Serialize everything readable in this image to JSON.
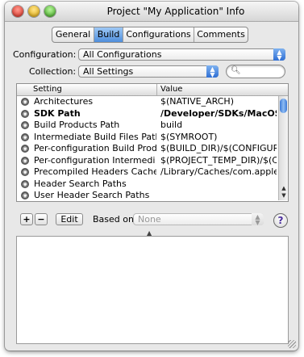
{
  "window": {
    "title": "Project \"My Application\" Info"
  },
  "tabs": [
    {
      "label": "General"
    },
    {
      "label": "Build",
      "selected": true
    },
    {
      "label": "Configurations"
    },
    {
      "label": "Comments"
    }
  ],
  "configuration": {
    "label": "Configuration:",
    "value": "All Configurations"
  },
  "collection": {
    "label": "Collection:",
    "value": "All Settings"
  },
  "search": {
    "placeholder": ""
  },
  "table": {
    "headers": {
      "setting": "Setting",
      "value": "Value"
    },
    "rows": [
      {
        "name": "Architectures",
        "value": "$(NATIVE_ARCH)",
        "bold": false
      },
      {
        "name": "SDK Path",
        "value": "/Developer/SDKs/MacOSX",
        "bold": true
      },
      {
        "name": "Build Products Path",
        "value": "build",
        "bold": false
      },
      {
        "name": "Intermediate Build Files Path",
        "value": "$(SYMROOT)",
        "bold": false
      },
      {
        "name": "Per-configuration Build Prod",
        "value": "$(BUILD_DIR)/$(CONFIGURAT",
        "bold": false
      },
      {
        "name": "Per-configuration Intermedi",
        "value": "$(PROJECT_TEMP_DIR)/$(CO",
        "bold": false
      },
      {
        "name": "Precompiled Headers Cache",
        "value": "/Library/Caches/com.apple.",
        "bold": false
      },
      {
        "name": "Header Search Paths",
        "value": "",
        "bold": false
      },
      {
        "name": "User Header Search Paths",
        "value": "",
        "bold": false
      }
    ]
  },
  "toolbar": {
    "add_label": "+",
    "remove_label": "−",
    "edit_label": "Edit",
    "based_on_label": "Based on:",
    "based_on_value": "None",
    "help_label": "?"
  },
  "colors": {
    "accent": "#4f8edc",
    "window_bg": "#e8e8e8"
  }
}
